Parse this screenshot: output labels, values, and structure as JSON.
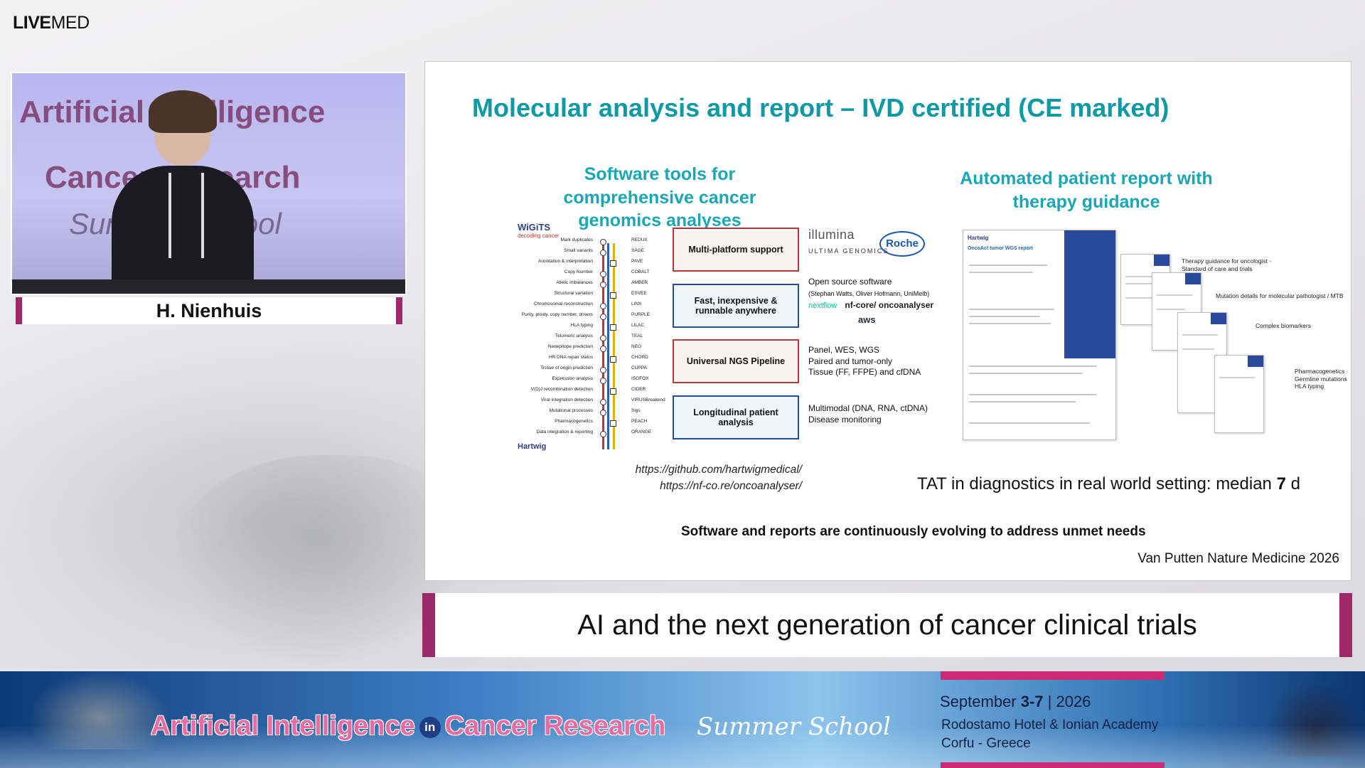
{
  "logo": {
    "bold": "LIVE",
    "light": "MED"
  },
  "speaker": {
    "name": "H. Nienhuis",
    "backdrop_line1": "Artificial Intelligence",
    "backdrop_line2": "Cancer Research",
    "backdrop_line3": "Summer School"
  },
  "slide": {
    "title": "Molecular analysis and report – IVD certified (CE marked)",
    "left_heading": "Software tools for comprehensive cancer genomics analyses",
    "right_heading": "Automated patient report with therapy guidance",
    "pipeline_brand": "WiGiTS",
    "pipeline_brand_sub": "decoding cancer",
    "pipeline_steps": [
      {
        "left": "Mark duplicates",
        "right": "REDUX"
      },
      {
        "left": "Small variants",
        "right": "SAGE"
      },
      {
        "left": "Annotation & interpretation",
        "right": "PAVE"
      },
      {
        "left": "Copy Number",
        "right": "COBALT"
      },
      {
        "left": "Allelic imbalances",
        "right": "AMBER"
      },
      {
        "left": "Structural variation",
        "right": "ESVEE"
      },
      {
        "left": "Chromosomal reconstruction",
        "right": "LINX"
      },
      {
        "left": "Purity, ploidy, copy number, drivers",
        "right": "PURPLE"
      },
      {
        "left": "HLA typing",
        "right": "LILAC"
      },
      {
        "left": "Telomeric analysis",
        "right": "TEAL"
      },
      {
        "left": "Neoepitope prediction",
        "right": "NEO"
      },
      {
        "left": "HR DNA repair status",
        "right": "CHORD"
      },
      {
        "left": "Tissue of origin prediction",
        "right": "CUPPA"
      },
      {
        "left": "Expression analysis",
        "right": "ISOFOX"
      },
      {
        "left": "V(D)J recombination detection",
        "right": "CIDER"
      },
      {
        "left": "Viral integration detection",
        "right": "VIRUSBreakend"
      },
      {
        "left": "Mutational processes",
        "right": "Sigs"
      },
      {
        "left": "Pharmacogenetics",
        "right": "PEACH"
      },
      {
        "left": "Data integration & reporting",
        "right": "ORANGE"
      }
    ],
    "pipeline_footer": "Hartwig",
    "boxes": [
      "Multi-platform support",
      "Fast, inexpensive & runnable anywhere",
      "Universal NGS Pipeline",
      "Longitudinal patient analysis"
    ],
    "logos": {
      "illumina": "illumina",
      "roche": "Roche",
      "ultima": "ULTIMA GENOMICS"
    },
    "open_source": "Open source software",
    "open_source_credit": "(Stephan Watts, Oliver Hofmann, UniMelb)",
    "nextflow": "nextflow",
    "nfcore": "nf-core/ oncoanalyser",
    "aws": "aws",
    "panel_text": [
      "Panel, WES, WGS",
      "Paired and tumor-only",
      "Tissue (FF, FFPE) and cfDNA"
    ],
    "multimodal_text": [
      "Multimodal (DNA, RNA, ctDNA)",
      "Disease monitoring"
    ],
    "links": [
      "https://github.com/hartwigmedical/",
      "https://nf-co.re/oncoanalyser/"
    ],
    "report_brand": "Hartwig",
    "report_title": "OncoAct tumor WGS report",
    "report_labels": [
      "Therapy guidance for oncologist - Standard of care and trials",
      "Mutation details for molecular pathologist / MTB",
      "Complex biomarkers",
      "Pharmacogenetics Germline mutations HLA typing"
    ],
    "tat_prefix": "TAT in diagnostics in real world setting: median ",
    "tat_value": "7",
    "tat_suffix": " d",
    "footer_note": "Software and reports are continuously evolving to address unmet needs",
    "citation": "Van Putten Nature Medicine 2026"
  },
  "lower_third": "AI and the next generation of cancer clinical trials",
  "banner": {
    "title_part1": "Artificial Intelligence",
    "title_in": "in",
    "title_part2": "Cancer Research",
    "summer": "Summer School",
    "dates_prefix": "September ",
    "dates_bold": "3-7",
    "dates_year": " | 2026",
    "venue_line1": "Rodostamo Hotel & Ionian Academy",
    "venue_line2": "Corfu - Greece"
  },
  "colors": {
    "accent_magenta": "#9c2a6a",
    "slide_teal": "#0e9aa5",
    "banner_pink": "#e86ba4"
  }
}
